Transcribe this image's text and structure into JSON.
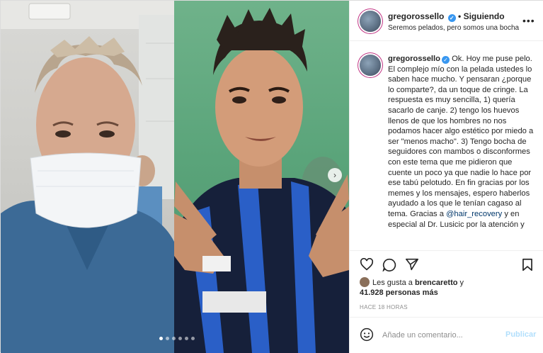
{
  "post": {
    "username": "gregorossello",
    "follow_separator": "•",
    "follow_status": "Siguiendo",
    "subtitle": "Seremos pelados, pero somos una bocha",
    "more_icon": "more-horizontal-icon",
    "caption_username": "gregorossello",
    "caption_part1": " Ok. Hoy me puse pelo. El complejo mío con la pelada ustedes lo saben hace mucho. Y pensaran ¿porque lo comparte?, da un toque de cringe. La respuesta es muy sencilla, 1) quería sacarlo de canje. 2) tengo los huevos llenos de que los hombres no nos podamos hacer algo estético por miedo a ser \"menos macho\". 3) Tengo bocha de seguidores con mambos o disconformes con este tema que me pidieron que cuente un poco ya que nadie lo hace por ese tabú pelotudo. En fin gracias por los memes y los mensajes, espero haberlos ayudado a los que le tenían cagaso al tema. Gracias a ",
    "caption_mention": "@hair_recovery",
    "caption_part2": " y en especial al Dr. Lusicic por la atención y",
    "likes_prefix": "Les gusta a ",
    "likes_user": "brencaretto",
    "likes_mid": " y",
    "likes_count": "41.928 personas más",
    "time_ago": "HACE 18 HORAS",
    "comment_placeholder": "Añade un comentario...",
    "publish_label": "Publicar",
    "carousel_total": 6,
    "carousel_active": 0,
    "colors": {
      "verified": "#3897f0",
      "mention": "#00376b",
      "publish": "#b2dffc",
      "muted": "#8e8e8e"
    }
  }
}
